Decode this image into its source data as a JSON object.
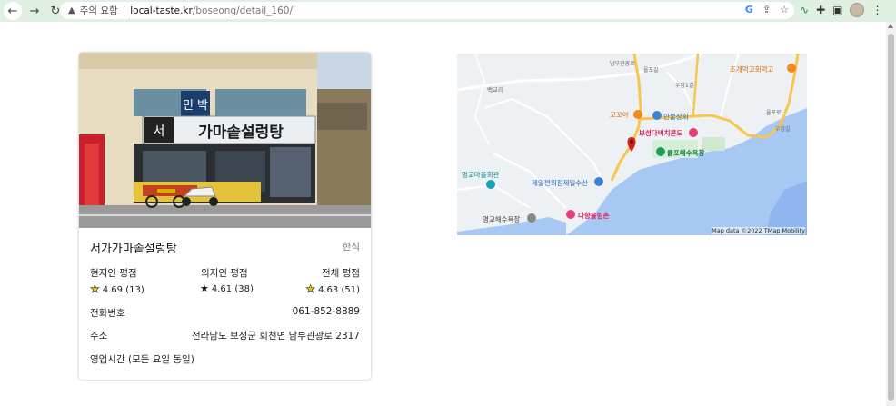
{
  "browser": {
    "warning_label": "주의 요함",
    "url_host": "local-taste.kr",
    "url_path": "/boseong/detail_160/"
  },
  "restaurant": {
    "photo_sign_main": "가마솥설렁탕",
    "photo_sign_top": "민 박",
    "name": "서가가마솥설렁탕",
    "category": "한식",
    "ratings": {
      "local": {
        "label": "현지인 평점",
        "value": "4.69 (13)",
        "icon": "gold-star-icon"
      },
      "visitor": {
        "label": "외지인 평점",
        "value": "4.61 (38)",
        "icon": "black-star-icon"
      },
      "overall": {
        "label": "전체 평점",
        "value": "4.63 (51)",
        "icon": "gold-star-icon"
      }
    },
    "phone_label": "전화번호",
    "phone": "061-852-8889",
    "address_label": "주소",
    "address": "전라남도 보성군 회천면 남부관광로 2317",
    "hours_label": "영업시간 (모든 요일 동일)"
  },
  "map": {
    "labels": {
      "joge": "조개먹고회먹고",
      "kkopoya": "꼬꼬야",
      "manmul": "만물상회",
      "boseong_beach": "보성다비치콘도",
      "yulpo": "율포해수욕장",
      "myeonggyo_hall": "명교마을회관",
      "jeil": "제일편의점제일수산",
      "myeonggyo_beach": "명교해수욕장",
      "dahyang": "다향울림촌",
      "baekgyori": "백교리",
      "road_a": "남부관광로",
      "road_b": "율포길",
      "road_c": "우암1길",
      "road_d": "율포로",
      "road_e": "우암길"
    },
    "credit": "Map data ©2022 TMap Mobility",
    "colors": {
      "water": "#a8c8f4",
      "road": "#f6c64e",
      "land": "#eef1f4"
    }
  }
}
